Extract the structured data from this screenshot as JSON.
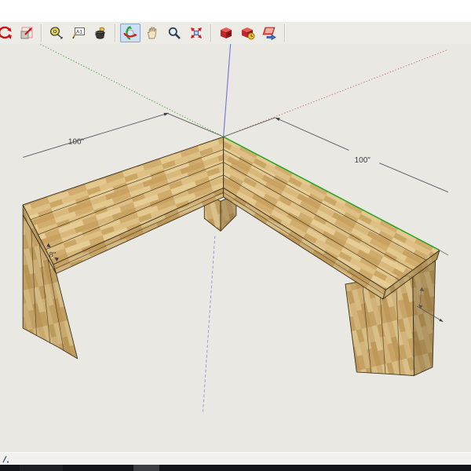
{
  "window": {
    "top_strip_text": ""
  },
  "toolbar": {
    "selected_tool": "orbit",
    "tools": [
      {
        "name": "rotate",
        "selected": false
      },
      {
        "name": "scale",
        "selected": false
      },
      {
        "name": "tape-measure",
        "selected": false
      },
      {
        "name": "dimension-text",
        "selected": false
      },
      {
        "name": "paint-bucket",
        "selected": false
      },
      {
        "name": "orbit",
        "selected": true
      },
      {
        "name": "pan",
        "selected": false
      },
      {
        "name": "zoom",
        "selected": false
      },
      {
        "name": "zoom-extents",
        "selected": false
      },
      {
        "name": "get-models",
        "selected": false
      },
      {
        "name": "share-model",
        "selected": false
      },
      {
        "name": "export-model",
        "selected": false
      }
    ]
  },
  "viewport": {
    "background": "#E9E8E3",
    "model": {
      "name": "l-shaped-corner-bench",
      "wood_base_color": "#D6B478"
    },
    "axes": {
      "red_dotted": "#C66A63",
      "green_solid": "#1FA51F",
      "green_dotted": "#3A9E3A",
      "blue_solid": "#7070DC",
      "blue_dotted": "#9090D8"
    },
    "dimensions": {
      "left_arm": {
        "label": "100\""
      },
      "right_arm": {
        "label": "100\""
      },
      "board_width": {
        "label": "8\""
      }
    }
  },
  "statusbar": {
    "message": ""
  },
  "colors": {
    "toolbar_bg": "#EDEBE6",
    "selected_tool_bg": "#CBE0F2",
    "statusbar_bg": "#F1F0EC",
    "taskbar_bg": "#12141A",
    "dimension_text": "#3C3C3C"
  }
}
